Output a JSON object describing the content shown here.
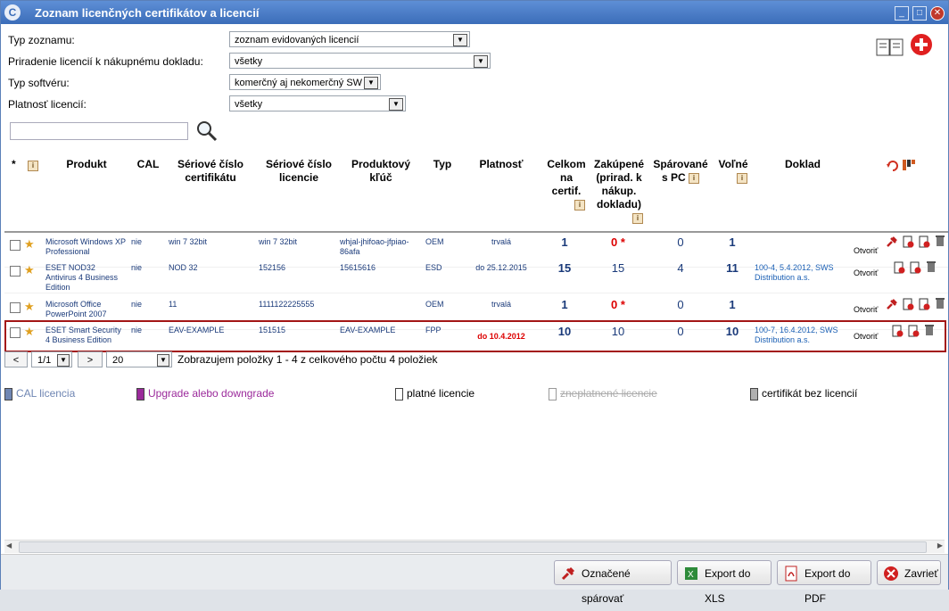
{
  "window": {
    "title": "Zoznam licenčných certifikátov a licencií"
  },
  "filters": [
    {
      "label": "Typ zoznamu:",
      "value": "zoznam evidovaných licencií"
    },
    {
      "label": "Priradenie licencií k nákupnému dokladu:",
      "value": "všetky"
    },
    {
      "label": "Typ softvéru:",
      "value": "komerčný aj nekomerčný SW"
    },
    {
      "label": "Platnosť licencií:",
      "value": "všetky"
    }
  ],
  "search": {
    "placeholder": ""
  },
  "columns": {
    "star": "*",
    "produkt": "Produkt",
    "cal": "CAL",
    "serial_cert_1": "Sériové číslo",
    "serial_cert_2": "certifikátu",
    "serial_lic_1": "Sériové číslo",
    "serial_lic_2": "licencie",
    "key_1": "Produktový",
    "key_2": "kľúč",
    "typ": "Typ",
    "platnost": "Platnosť",
    "celkom_1": "Celkom",
    "celkom_2": "na",
    "celkom_3": "certif.",
    "zakup_1": "Zakúpené",
    "zakup_2": "(prirad. k",
    "zakup_3": "nákup.",
    "zakup_4": "dokladu)",
    "sparovane_1": "Spárované",
    "sparovane_2": "s PC",
    "volne": "Voľné",
    "doklad": "Doklad"
  },
  "rows": [
    {
      "produkt": "Microsoft Windows XP Professional",
      "cal": "nie",
      "serial_cert": "win 7 32bit",
      "serial_lic": "win 7 32bit",
      "key": "whjal-jhifoao-jfpiao-86afa",
      "typ": "OEM",
      "platnost": "trvalá",
      "celkom": "1",
      "zakupene": "0",
      "zakupene_mark": "*",
      "sparovane": "0",
      "volne": "1",
      "doklad": "",
      "open": "Otvoriť"
    },
    {
      "produkt": "ESET NOD32 Antivirus 4 Business Edition",
      "cal": "nie",
      "serial_cert": "NOD 32",
      "serial_lic": "152156",
      "key": "15615616",
      "typ": "ESD",
      "platnost": "do 25.12.2015",
      "celkom": "15",
      "zakupene": "15",
      "zakupene_mark": "",
      "sparovane": "4",
      "volne": "11",
      "doklad": "100-4, 5.4.2012, SWS Distribution a.s.",
      "open": "Otvoriť"
    },
    {
      "produkt": "Microsoft Office PowerPoint 2007",
      "cal": "nie",
      "serial_cert": "11",
      "serial_lic": "1111122225555",
      "key": "",
      "typ": "OEM",
      "platnost": "trvalá",
      "celkom": "1",
      "zakupene": "0",
      "zakupene_mark": "*",
      "sparovane": "0",
      "volne": "1",
      "doklad": "",
      "open": "Otvoriť"
    },
    {
      "produkt": "ESET Smart Security 4 Business Edition",
      "cal": "nie",
      "serial_cert": "EAV-EXAMPLE",
      "serial_lic": "151515",
      "key": "EAV-EXAMPLE",
      "typ": "FPP",
      "platnost": "do 10.4.2012",
      "celkom": "10",
      "zakupene": "10",
      "zakupene_mark": "",
      "sparovane": "0",
      "volne": "10",
      "doklad": "100-7, 16.4.2012, SWS Distribution a.s.",
      "open": "Otvoriť"
    }
  ],
  "pager": {
    "prev": "<",
    "page": "1/1",
    "next": ">",
    "size": "20",
    "info": "Zobrazujem položky 1 - 4 z celkového počtu 4 položiek"
  },
  "legend": [
    {
      "label": "CAL licencia",
      "color": "#6f86b3"
    },
    {
      "label": "Upgrade alebo downgrade",
      "color": "#9b2a9b"
    },
    {
      "label": "platné licencie",
      "color": "#ffffff"
    },
    {
      "label": "zneplatnené licencie",
      "color": "#ffffff"
    },
    {
      "label": "certifikát bez licencií",
      "color": "#b0b0b0"
    }
  ],
  "buttons": {
    "pair": "Označené spárovať",
    "xls": "Export do XLS",
    "pdf": "Export do PDF",
    "close": "Zavrieť"
  },
  "colors": {
    "accent": "#3b6db9",
    "error": "#dd0000",
    "selection": "#a31515"
  }
}
